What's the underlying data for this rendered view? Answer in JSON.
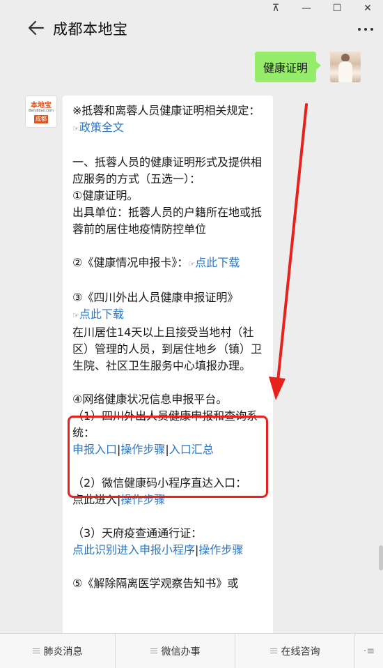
{
  "window": {
    "controls": [
      "⊼",
      "—",
      "☐",
      "✕"
    ]
  },
  "header": {
    "title": "成都本地宝"
  },
  "chat": {
    "user_message": "健康证明",
    "bot_avatar": {
      "logo_text": "本地宝",
      "domain_text": "Bendibao.com",
      "city_badge": "成都"
    },
    "bot_message": {
      "line1_prefix": "※抵蓉和离蓉人员健康证明相关规定：",
      "policy_link": "政策全文",
      "section1_title": "一、抵蓉人员的健康证明形式及提供相应服务的方式（五选一）：",
      "item1": "①健康证明。",
      "item1_detail": "出具单位：抵蓉人员的户籍所在地或抵蓉前的居住地疫情防控单位",
      "item2_prefix": "②《健康情况申报卡》：",
      "item2_link": "点此下载",
      "item3_title": "③《四川外出人员健康申报证明》",
      "item3_link": "点此下载",
      "item3_detail": "在川居住14天以上且接受当地村（社区）管理的人员，到居住地乡（镇）卫生院、社区卫生服务中心填报办理。",
      "item4_title": "④网络健康状况信息申报平台。",
      "item4_sub1": "（1）四川外出人员健康申报和查询系统：",
      "item4_sub1_links": [
        "申报入口",
        "操作步骤",
        "入口汇总"
      ],
      "item4_sub2": "（2）微信健康码小程序直达入口：",
      "item4_sub2_plain": "点此进入",
      "item4_sub2_link": "操作步骤",
      "item4_sub3": "（3）天府疫查通通行证：",
      "item4_sub3_links": [
        "点此识别进入申报小程序",
        "操作步骤"
      ],
      "item5_partial": "⑤《解除隔离医学观察告知书》或"
    }
  },
  "bottom_menu": {
    "items": [
      "肺炎消息",
      "微信办事",
      "在线咨询"
    ]
  },
  "colors": {
    "background": "#ededed",
    "user_bubble": "#95ec69",
    "link": "#2b76c4",
    "highlight": "#e8211d"
  }
}
